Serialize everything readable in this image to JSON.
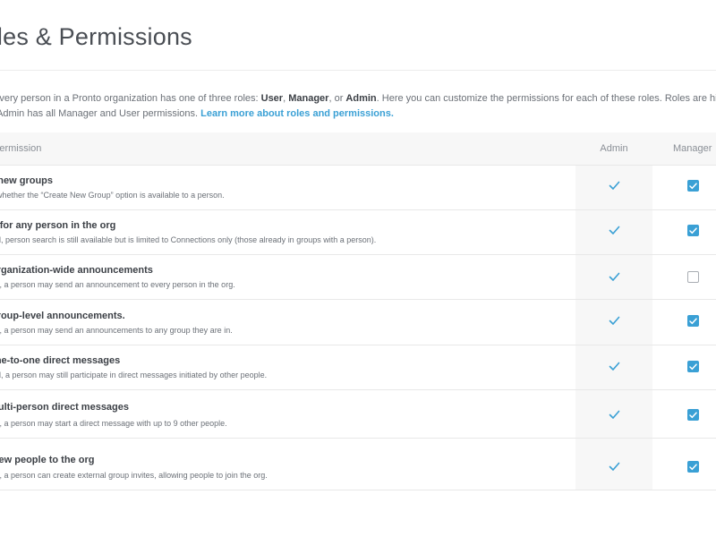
{
  "page": {
    "title": "Roles & Permissions"
  },
  "intro": {
    "line1_a": "Every person in a Pronto organization has one of three roles: ",
    "role_user": "User",
    "sep1": ", ",
    "role_manager": "Manager",
    "sep2": ", or ",
    "role_admin": "Admin",
    "line1_b": ". Here you can customize the permissions for each of these roles. Roles are hierarchical - a Manager has all User permissions,",
    "line2_a": "and an Admin has all Manager and User permissions. ",
    "learn_more": "Learn more about roles and permissions."
  },
  "table": {
    "headers": {
      "permission": "Permission",
      "admin": "Admin",
      "manager": "Manager"
    },
    "rows": [
      {
        "title": "Create new groups",
        "desc": "Controls whether the “Create New Group” option is available to a person.",
        "admin": true,
        "manager": true
      },
      {
        "title": "Search for any person in the org",
        "desc": "If disabled, person search is still available but is limited to Connections only (those already in groups with a person).",
        "admin": true,
        "manager": true
      },
      {
        "title": "Send organization-wide announcements",
        "desc": "If enabled, a person may send an announcement to every person in the org.",
        "admin": true,
        "manager": false
      },
      {
        "title": "Send group-level announcements.",
        "desc": "If enabled, a person may send an announcements to any group they are in.",
        "admin": true,
        "manager": true
      },
      {
        "title": "Start one-to-one direct messages",
        "desc": "If disabled, a person may still participate in direct messages initiated by other people.",
        "admin": true,
        "manager": true
      },
      {
        "title": "Start multi-person direct messages",
        "desc": "If enabled, a person may start a direct message with up to 9 other people.",
        "admin": true,
        "manager": true
      },
      {
        "title": "Invite new people to the org",
        "desc": "If enabled, a person can create external group invites, allowing people to join the org.",
        "admin": true,
        "manager": true
      }
    ]
  },
  "colors": {
    "accent": "#3aa0d5",
    "header_bg": "#f7f7f7",
    "divider": "#e8e8e8"
  },
  "icons": {
    "admin_check": "checkmark-icon",
    "manager_check": "checkbox-checked-icon"
  }
}
